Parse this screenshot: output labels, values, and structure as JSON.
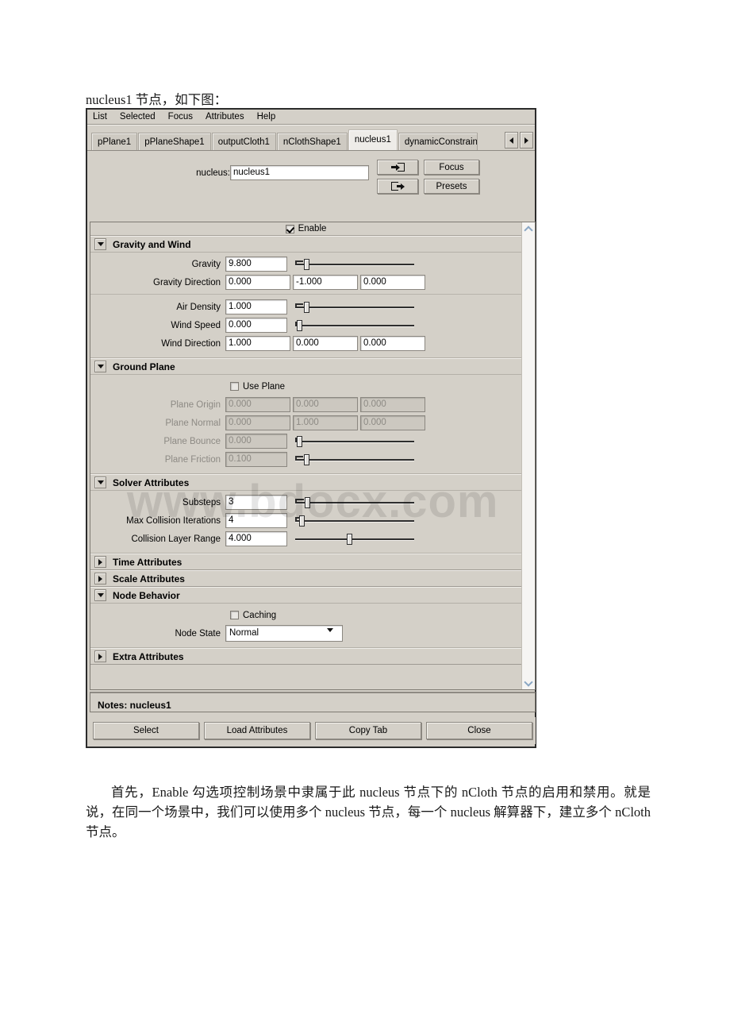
{
  "document": {
    "intro_line": "nucleus1 节点，如下图：",
    "closing_paragraph": "首先，Enable 勾选项控制场景中隶属于此 nucleus 节点下的 nCloth 节点的启用和禁用。就是说，在同一个场景中，我们可以使用多个 nucleus 节点，每一个 nucleus 解算器下，建立多个 nCloth 节点。",
    "watermark": "www.bdocx.com"
  },
  "window": {
    "menu": [
      "List",
      "Selected",
      "Focus",
      "Attributes",
      "Help"
    ],
    "tabs": [
      {
        "label": "pPlane1",
        "active": false
      },
      {
        "label": "pPlaneShape1",
        "active": false
      },
      {
        "label": "outputCloth1",
        "active": false
      },
      {
        "label": "nClothShape1",
        "active": false
      },
      {
        "label": "nucleus1",
        "active": true
      },
      {
        "label": "dynamicConstraintSha",
        "active": false
      }
    ],
    "tab_nav": {
      "prev": "◀",
      "next": "▶"
    },
    "header": {
      "node_label": "nucleus:",
      "node_value": "nucleus1",
      "focus_label": "Focus",
      "presets_label": "Presets",
      "load_icon": "arrow-into-box-icon",
      "save_icon": "arrow-out-of-box-icon"
    },
    "enable": {
      "label": "Enable",
      "checked": true
    },
    "sections": [
      {
        "title": "Gravity and Wind",
        "expanded": true,
        "groups": [
          {
            "rows": [
              {
                "label": "Gravity",
                "fields": [
                  "9.800"
                ],
                "slider": {
                  "pos": 8,
                  "cap": "left-bracket"
                },
                "disabled": false
              },
              {
                "label": "Gravity Direction",
                "fields": [
                  "0.000",
                  "-1.000",
                  "0.000"
                ],
                "slider": null,
                "disabled": false
              }
            ]
          },
          {
            "rows": [
              {
                "label": "Air Density",
                "fields": [
                  "1.000"
                ],
                "slider": {
                  "pos": 8,
                  "cap": "left-bracket"
                },
                "disabled": false
              },
              {
                "label": "Wind Speed",
                "fields": [
                  "0.000"
                ],
                "slider": {
                  "pos": 1,
                  "cap": "tick"
                },
                "disabled": false
              },
              {
                "label": "Wind Direction",
                "fields": [
                  "1.000",
                  "0.000",
                  "0.000"
                ],
                "slider": null,
                "disabled": false
              }
            ]
          }
        ]
      },
      {
        "title": "Ground Plane",
        "expanded": true,
        "checkbox": {
          "label": "Use Plane",
          "checked": false
        },
        "groups": [
          {
            "rows": [
              {
                "label": "Plane Origin",
                "fields": [
                  "0.000",
                  "0.000",
                  "0.000"
                ],
                "slider": null,
                "disabled": true
              },
              {
                "label": "Plane Normal",
                "fields": [
                  "0.000",
                  "1.000",
                  "0.000"
                ],
                "slider": null,
                "disabled": true
              },
              {
                "label": "Plane Bounce",
                "fields": [
                  "0.000"
                ],
                "slider": {
                  "pos": 1,
                  "cap": "tick"
                },
                "disabled": true
              },
              {
                "label": "Plane Friction",
                "fields": [
                  "0.100"
                ],
                "slider": {
                  "pos": 8,
                  "cap": "left-bracket"
                },
                "disabled": true
              }
            ]
          }
        ]
      },
      {
        "title": "Solver Attributes",
        "expanded": true,
        "groups": [
          {
            "rows": [
              {
                "label": "Substeps",
                "fields": [
                  "3"
                ],
                "slider": {
                  "pos": 9,
                  "cap": "left-bracket"
                },
                "disabled": false
              },
              {
                "label": "Max Collision Iterations",
                "fields": [
                  "4"
                ],
                "slider": {
                  "pos": 4,
                  "cap": "small-bracket"
                },
                "disabled": false
              },
              {
                "label": "Collision Layer Range",
                "fields": [
                  "4.000"
                ],
                "slider": {
                  "pos": 45,
                  "cap": "none"
                },
                "disabled": false
              }
            ]
          }
        ]
      },
      {
        "title": "Time Attributes",
        "expanded": false,
        "groups": []
      },
      {
        "title": "Scale Attributes",
        "expanded": false,
        "groups": []
      },
      {
        "title": "Node Behavior",
        "expanded": true,
        "checkbox": {
          "label": "Caching",
          "checked": false
        },
        "groups": [
          {
            "rows": [
              {
                "label": "Node State",
                "dropdown": {
                  "value": "Normal"
                }
              }
            ]
          }
        ]
      },
      {
        "title": "Extra Attributes",
        "expanded": false,
        "groups": []
      }
    ],
    "notes": "Notes:  nucleus1",
    "footer_buttons": [
      "Select",
      "Load Attributes",
      "Copy Tab",
      "Close"
    ]
  }
}
